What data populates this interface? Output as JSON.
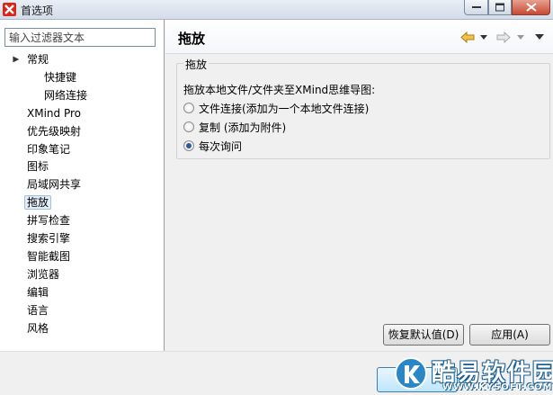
{
  "window": {
    "title": "首选项",
    "icons": {
      "app": "xmind-icon",
      "minimize": "minimize-icon",
      "maximize": "maximize-icon",
      "close": "close-icon"
    }
  },
  "filter": {
    "placeholder": "输入过滤器文本"
  },
  "tree": {
    "items": [
      {
        "label": "常规",
        "level": 0,
        "expanded": true
      },
      {
        "label": "快捷键",
        "level": 2
      },
      {
        "label": "网络连接",
        "level": 2
      },
      {
        "label": "XMind Pro",
        "level": 0
      },
      {
        "label": "优先级映射",
        "level": 0
      },
      {
        "label": "印象笔记",
        "level": 0
      },
      {
        "label": "图标",
        "level": 0
      },
      {
        "label": "局域网共享",
        "level": 0
      },
      {
        "label": "拖放",
        "level": 0,
        "selected": true
      },
      {
        "label": "拼写检查",
        "level": 0
      },
      {
        "label": "搜索引擎",
        "level": 0
      },
      {
        "label": "智能截图",
        "level": 0
      },
      {
        "label": "浏览器",
        "level": 0
      },
      {
        "label": "编辑",
        "level": 0
      },
      {
        "label": "语言",
        "level": 0
      },
      {
        "label": "风格",
        "level": 0
      }
    ]
  },
  "page": {
    "title": "拖放",
    "nav_icons": [
      "back-arrow-icon",
      "chevron-down-icon",
      "forward-arrow-icon",
      "chevron-down-icon",
      "view-menu-icon"
    ],
    "group": {
      "title": "拖放",
      "description": "拖放本地文件/文件夹至XMind思维导图:",
      "options": [
        {
          "label": "文件连接(添加为一个本地文件连接)",
          "checked": false
        },
        {
          "label": "复制 (添加为附件)",
          "checked": false
        },
        {
          "label": "每次询问",
          "checked": true
        }
      ]
    },
    "buttons": {
      "restore": "恢复默认值(D)",
      "apply": "应用(A)"
    }
  },
  "bottom": {
    "ok_label": ""
  },
  "watermark": {
    "text": "酷易软件园",
    "sub": "WWW.KYSOFT.COM"
  },
  "colors": {
    "selection": "#e4eef9",
    "accent": "#2e5a95",
    "nav_back": "#e0a020"
  }
}
